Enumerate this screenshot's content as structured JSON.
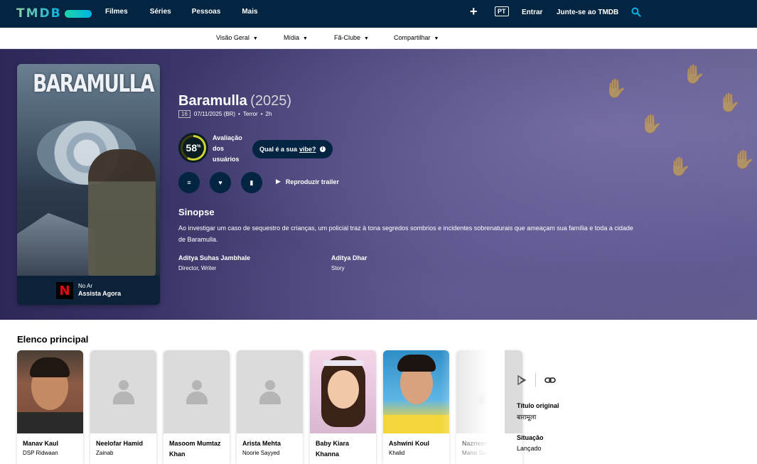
{
  "nav": {
    "logo": "TMDB",
    "links": [
      "Filmes",
      "Séries",
      "Pessoas",
      "Mais"
    ],
    "lang": "PT",
    "login": "Entrar",
    "join": "Junte-se ao TMDB"
  },
  "subnav": [
    {
      "label": "Visão Geral"
    },
    {
      "label": "Mídia"
    },
    {
      "label": "Fã-Clube"
    },
    {
      "label": "Compartilhar"
    }
  ],
  "movie": {
    "poster_title": "BARAMULLA",
    "title": "Baramulla",
    "year": "(2025)",
    "certification": "16",
    "release": "07/11/2025 (BR)",
    "genre": "Terror",
    "runtime": "2h",
    "score": "58",
    "score_percent": 58,
    "score_label_lines": [
      "Avaliação",
      "dos",
      "usuários"
    ],
    "vibe_prefix": "Qual é a sua",
    "vibe_link": "vibe?",
    "trailer": "Reproduzir trailer",
    "streaming_l1": "No Ar",
    "streaming_l2": "Assista Agora",
    "overview_title": "Sinopse",
    "overview": "Ao investigar um caso de sequestro de crianças, um policial traz à tona segredos sombrios e incidentes sobrenaturais que ameaçam sua família e toda a cidade de Baramulla.",
    "crew": [
      {
        "name": "Aditya Suhas Jambhale",
        "role": "Director, Writer"
      },
      {
        "name": "Aditya Dhar",
        "role": "Story"
      }
    ]
  },
  "cast_title": "Elenco principal",
  "cast": [
    {
      "name": "Manav Kaul",
      "character": "DSP Ridwaan",
      "photo": true
    },
    {
      "name": "Neelofar Hamid",
      "character": "Zainab",
      "photo": false
    },
    {
      "name": "Masoom Mumtaz Khan",
      "character": "",
      "photo": false
    },
    {
      "name": "Arista Mehta",
      "character": "Noorie Sayyed",
      "photo": false
    },
    {
      "name": "Baby Kiara Khanna",
      "character": "",
      "photo": true
    },
    {
      "name": "Ashwini Koul",
      "character": "Khalid",
      "photo": true
    },
    {
      "name": "Nazneen M",
      "character": "Mansi Sapru",
      "photo": false
    }
  ],
  "facts": {
    "original_title_label": "Título original",
    "original_title": "बारामूला",
    "status_label": "Situação",
    "status": "Lançado"
  },
  "colors": {
    "nav_bg": "#032541",
    "score_ring": "#d2d531",
    "accent": "#01b4e4"
  }
}
